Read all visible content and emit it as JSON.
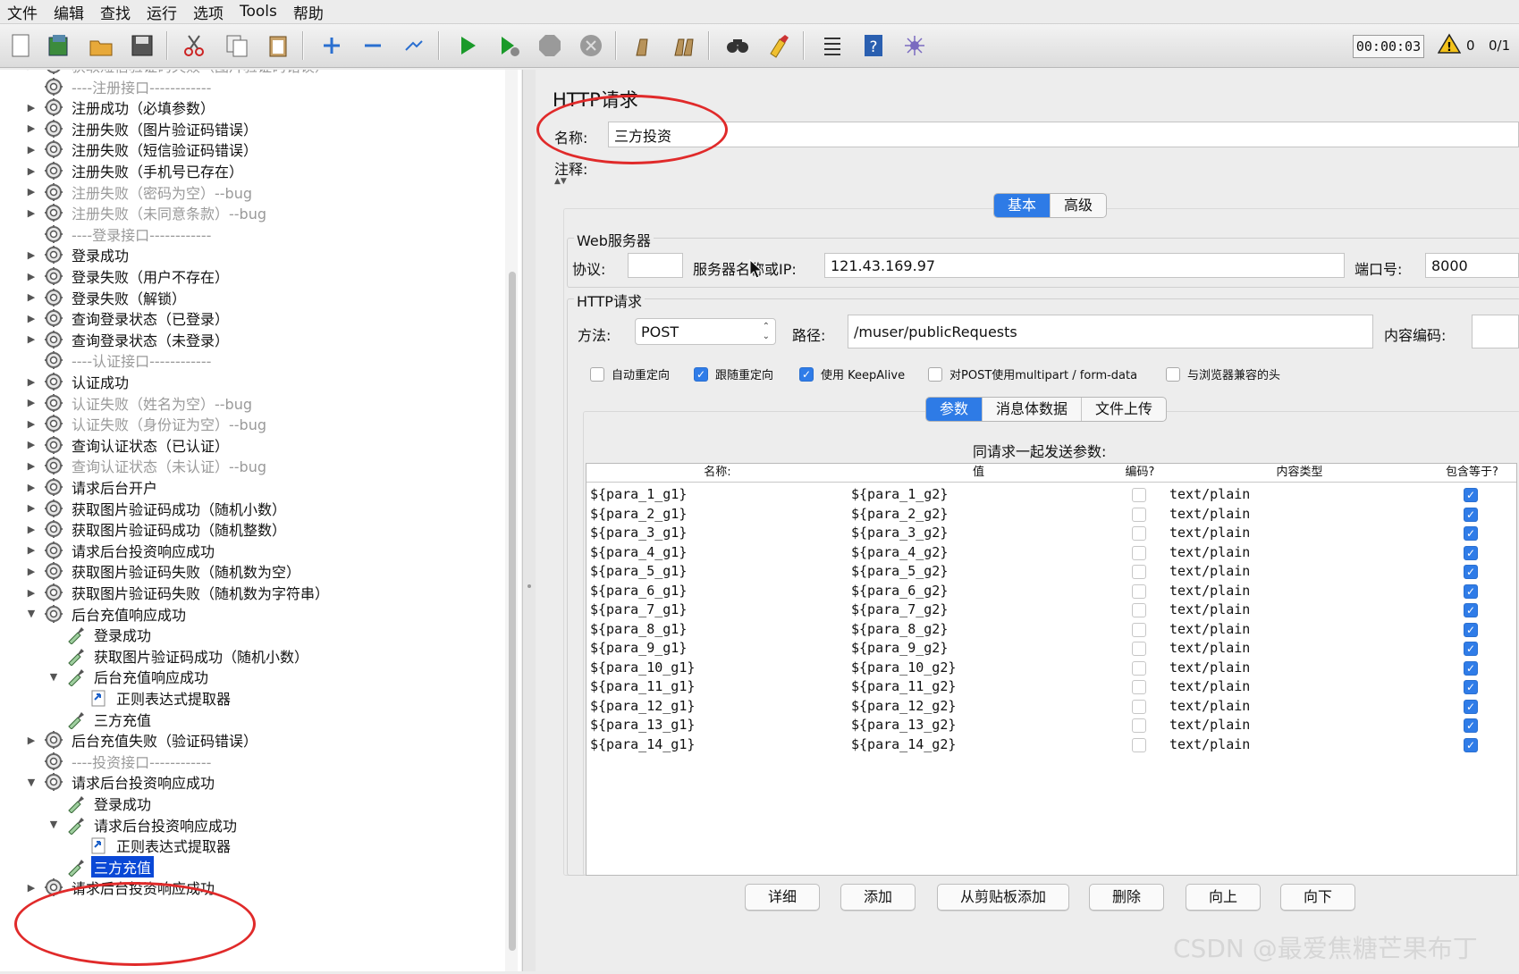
{
  "menu": [
    "文件",
    "编辑",
    "查找",
    "运行",
    "选项",
    "Tools",
    "帮助"
  ],
  "toolbar": {
    "icons": [
      "new-icon",
      "templates-icon",
      "open-icon",
      "save-icon",
      "cut-icon",
      "copy-icon",
      "paste-icon",
      "expand-icon",
      "collapse-icon",
      "toggle-icon",
      "start-icon",
      "start-no-pauses-icon",
      "stop-icon",
      "shutdown-icon",
      "clear-icon",
      "clear-all-icon",
      "search-icon",
      "reset-search-icon",
      "function-helper-icon",
      "help-icon",
      "remote-icon"
    ],
    "timer": "00:00:03",
    "warnings": "0",
    "threads": "0/1"
  },
  "tree": [
    {
      "label": "获取短信验证码失败（图片验证码错误）",
      "type": "sampler",
      "dim": true,
      "level": 0,
      "toggle": "▶"
    },
    {
      "label": "----注册接口------------",
      "type": "sampler",
      "dim": true,
      "level": 0,
      "toggle": ""
    },
    {
      "label": "注册成功（必填参数）",
      "type": "sampler",
      "dim": false,
      "level": 0,
      "toggle": "▶"
    },
    {
      "label": "注册失败（图片验证码错误）",
      "type": "sampler",
      "dim": false,
      "level": 0,
      "toggle": "▶"
    },
    {
      "label": "注册失败（短信验证码错误）",
      "type": "sampler",
      "dim": false,
      "level": 0,
      "toggle": "▶"
    },
    {
      "label": "注册失败（手机号已存在）",
      "type": "sampler",
      "dim": false,
      "level": 0,
      "toggle": "▶"
    },
    {
      "label": "注册失败（密码为空）--bug",
      "type": "sampler",
      "dim": true,
      "level": 0,
      "toggle": "▶"
    },
    {
      "label": "注册失败（未同意条款）--bug",
      "type": "sampler",
      "dim": true,
      "level": 0,
      "toggle": "▶"
    },
    {
      "label": "----登录接口------------",
      "type": "sampler",
      "dim": true,
      "level": 0,
      "toggle": ""
    },
    {
      "label": "登录成功",
      "type": "sampler",
      "dim": false,
      "level": 0,
      "toggle": "▶"
    },
    {
      "label": "登录失败（用户不存在）",
      "type": "sampler",
      "dim": false,
      "level": 0,
      "toggle": "▶"
    },
    {
      "label": "登录失败（解锁）",
      "type": "sampler",
      "dim": false,
      "level": 0,
      "toggle": "▶"
    },
    {
      "label": "查询登录状态（已登录）",
      "type": "sampler",
      "dim": false,
      "level": 0,
      "toggle": "▶"
    },
    {
      "label": "查询登录状态（未登录）",
      "type": "sampler",
      "dim": false,
      "level": 0,
      "toggle": "▶"
    },
    {
      "label": "----认证接口------------",
      "type": "sampler",
      "dim": true,
      "level": 0,
      "toggle": ""
    },
    {
      "label": "认证成功",
      "type": "sampler",
      "dim": false,
      "level": 0,
      "toggle": "▶"
    },
    {
      "label": "认证失败（姓名为空）--bug",
      "type": "sampler",
      "dim": true,
      "level": 0,
      "toggle": "▶"
    },
    {
      "label": "认证失败（身份证为空）--bug",
      "type": "sampler",
      "dim": true,
      "level": 0,
      "toggle": "▶"
    },
    {
      "label": "查询认证状态（已认证）",
      "type": "sampler",
      "dim": false,
      "level": 0,
      "toggle": "▶"
    },
    {
      "label": "查询认证状态（未认证）--bug",
      "type": "sampler",
      "dim": true,
      "level": 0,
      "toggle": "▶"
    },
    {
      "label": "请求后台开户",
      "type": "sampler",
      "dim": false,
      "level": 0,
      "toggle": "▶"
    },
    {
      "label": "获取图片验证码成功（随机小数）",
      "type": "sampler",
      "dim": false,
      "level": 0,
      "toggle": "▶"
    },
    {
      "label": "获取图片验证码成功（随机整数）",
      "type": "sampler",
      "dim": false,
      "level": 0,
      "toggle": "▶"
    },
    {
      "label": "请求后台投资响应成功",
      "type": "sampler",
      "dim": false,
      "level": 0,
      "toggle": "▶"
    },
    {
      "label": "获取图片验证码失败（随机数为空）",
      "type": "sampler",
      "dim": false,
      "level": 0,
      "toggle": "▶"
    },
    {
      "label": "获取图片验证码失败（随机数为字符串）",
      "type": "sampler",
      "dim": false,
      "level": 0,
      "toggle": "▶"
    },
    {
      "label": "后台充值响应成功",
      "type": "sampler",
      "dim": false,
      "level": 0,
      "toggle": "▼"
    },
    {
      "label": "登录成功",
      "type": "pipette",
      "dim": false,
      "level": 1,
      "toggle": ""
    },
    {
      "label": "获取图片验证码成功（随机小数）",
      "type": "pipette",
      "dim": false,
      "level": 1,
      "toggle": ""
    },
    {
      "label": "后台充值响应成功",
      "type": "pipette",
      "dim": false,
      "level": 1,
      "toggle": "▼"
    },
    {
      "label": "正则表达式提取器",
      "type": "extractor",
      "dim": false,
      "level": 2,
      "toggle": ""
    },
    {
      "label": "三方充值",
      "type": "pipette",
      "dim": false,
      "level": 1,
      "toggle": ""
    },
    {
      "label": "后台充值失败（验证码错误）",
      "type": "sampler",
      "dim": false,
      "level": 0,
      "toggle": "▶"
    },
    {
      "label": "----投资接口------------",
      "type": "sampler",
      "dim": true,
      "level": 0,
      "toggle": ""
    },
    {
      "label": "请求后台投资响应成功",
      "type": "sampler",
      "dim": false,
      "level": 0,
      "toggle": "▼"
    },
    {
      "label": "登录成功",
      "type": "pipette",
      "dim": false,
      "level": 1,
      "toggle": ""
    },
    {
      "label": "请求后台投资响应成功",
      "type": "pipette",
      "dim": false,
      "level": 1,
      "toggle": "▼"
    },
    {
      "label": "正则表达式提取器",
      "type": "extractor",
      "dim": false,
      "level": 2,
      "toggle": ""
    },
    {
      "label": "三方充值",
      "type": "pipette",
      "dim": false,
      "level": 1,
      "toggle": "",
      "selected": true
    },
    {
      "label": "请求后台投资响应成功",
      "type": "sampler",
      "dim": false,
      "level": 0,
      "toggle": "▶"
    }
  ],
  "panel": {
    "title": "HTTP请求",
    "name_label": "名称:",
    "name_value": "三方投资",
    "comment_label": "注释:",
    "main_tabs": [
      "基本",
      "高级"
    ],
    "web_server": {
      "legend": "Web服务器",
      "protocol_label": "协议:",
      "protocol_value": "",
      "server_label": "服务器名称或IP:",
      "server_value": "121.43.169.97",
      "port_label": "端口号:",
      "port_value": "8000"
    },
    "http_request": {
      "legend": "HTTP请求",
      "method_label": "方法:",
      "method_value": "POST",
      "path_label": "路径:",
      "path_value": "/muser/publicRequests",
      "encoding_label": "内容编码:",
      "encoding_value": ""
    },
    "options": [
      {
        "label": "自动重定向",
        "checked": false
      },
      {
        "label": "跟随重定向",
        "checked": true
      },
      {
        "label": "使用 KeepAlive",
        "checked": true
      },
      {
        "label": "对POST使用multipart / form-data",
        "checked": false
      },
      {
        "label": "与浏览器兼容的头",
        "checked": false
      }
    ],
    "sub_tabs": [
      "参数",
      "消息体数据",
      "文件上传"
    ],
    "params_caption": "同请求一起发送参数:",
    "columns": [
      "名称:",
      "值",
      "编码?",
      "内容类型",
      "包含等于?"
    ],
    "rows": [
      {
        "name": "${para_1_g1}",
        "value": "${para_1_g2}",
        "encode": false,
        "type": "text/plain",
        "include_equals": true
      },
      {
        "name": "${para_2_g1}",
        "value": "${para_2_g2}",
        "encode": false,
        "type": "text/plain",
        "include_equals": true
      },
      {
        "name": "${para_3_g1}",
        "value": "${para_3_g2}",
        "encode": false,
        "type": "text/plain",
        "include_equals": true
      },
      {
        "name": "${para_4_g1}",
        "value": "${para_4_g2}",
        "encode": false,
        "type": "text/plain",
        "include_equals": true
      },
      {
        "name": "${para_5_g1}",
        "value": "${para_5_g2}",
        "encode": false,
        "type": "text/plain",
        "include_equals": true
      },
      {
        "name": "${para_6_g1}",
        "value": "${para_6_g2}",
        "encode": false,
        "type": "text/plain",
        "include_equals": true
      },
      {
        "name": "${para_7_g1}",
        "value": "${para_7_g2}",
        "encode": false,
        "type": "text/plain",
        "include_equals": true
      },
      {
        "name": "${para_8_g1}",
        "value": "${para_8_g2}",
        "encode": false,
        "type": "text/plain",
        "include_equals": true
      },
      {
        "name": "${para_9_g1}",
        "value": "${para_9_g2}",
        "encode": false,
        "type": "text/plain",
        "include_equals": true
      },
      {
        "name": "${para_10_g1}",
        "value": "${para_10_g2}",
        "encode": false,
        "type": "text/plain",
        "include_equals": true
      },
      {
        "name": "${para_11_g1}",
        "value": "${para_11_g2}",
        "encode": false,
        "type": "text/plain",
        "include_equals": true
      },
      {
        "name": "${para_12_g1}",
        "value": "${para_12_g2}",
        "encode": false,
        "type": "text/plain",
        "include_equals": true
      },
      {
        "name": "${para_13_g1}",
        "value": "${para_13_g2}",
        "encode": false,
        "type": "text/plain",
        "include_equals": true
      },
      {
        "name": "${para_14_g1}",
        "value": "${para_14_g2}",
        "encode": false,
        "type": "text/plain",
        "include_equals": true
      }
    ],
    "buttons": [
      "详细",
      "添加",
      "从剪贴板添加",
      "删除",
      "向上",
      "向下"
    ]
  },
  "watermark": "CSDN @最爱焦糖芒果布丁",
  "colors": {
    "accent": "#2f7ce8",
    "selection": "#0a48d6",
    "annotation": "#e02a2a"
  }
}
